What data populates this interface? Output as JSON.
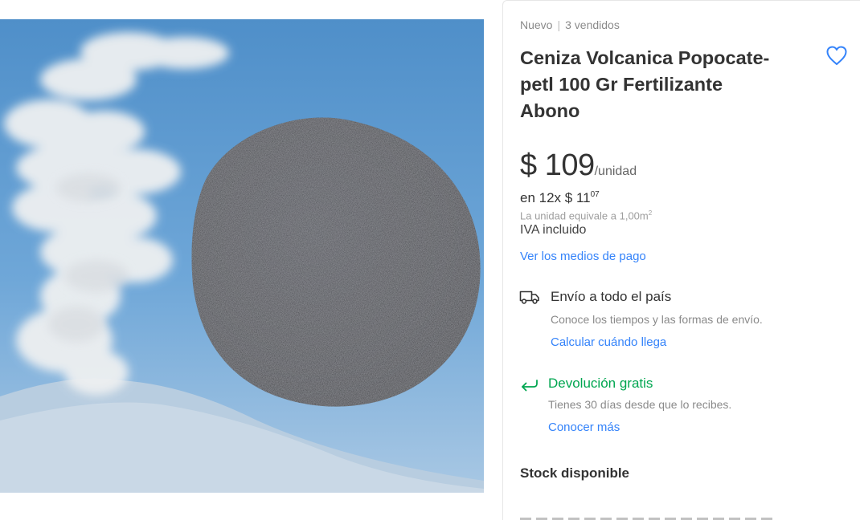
{
  "listing": {
    "condition": "Nuevo",
    "separator": "|",
    "sold": "3 vendidos",
    "title_lines": [
      "Ceniza Volcanica Popocate-",
      "petl 100 Gr Fertilizante",
      "Abono"
    ]
  },
  "price": {
    "amount": "$ 109",
    "unit": "/unidad",
    "installments_prefix": "en 12x $ 11",
    "installments_cents": "07",
    "unit_equivalence": "La unidad equivale a 1,00m",
    "unit_equivalence_sup": "2",
    "tax_note": "IVA incluido",
    "payment_link": "Ver los medios de pago"
  },
  "shipping": {
    "icon": "truck-icon",
    "title": "Envío a todo el país",
    "description": "Conoce los tiempos y las formas de envío.",
    "link": "Calcular cuándo llega"
  },
  "returns": {
    "icon": "return-arrow-icon",
    "title": "Devolución gratis",
    "description": "Tienes 30 días desde que lo recibes.",
    "link": "Conocer más"
  },
  "stock": {
    "label": "Stock disponible"
  },
  "colors": {
    "link_blue": "#3483fa",
    "success_green": "#00a650",
    "text_dark": "#333333",
    "text_muted": "#8a8a8a"
  }
}
